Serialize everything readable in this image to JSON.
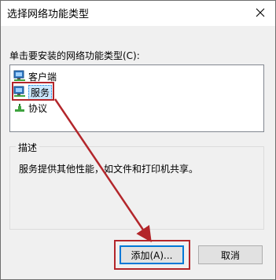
{
  "window": {
    "title": "选择网络功能类型"
  },
  "prompt": "单击要安装的网络功能类型(C):",
  "list": {
    "items": [
      {
        "label": "客户端",
        "icon": "client-network-icon"
      },
      {
        "label": "服务",
        "icon": "service-network-icon",
        "selected": true
      },
      {
        "label": "协议",
        "icon": "protocol-icon"
      }
    ]
  },
  "description": {
    "title": "描述",
    "text": "服务提供其他性能，如文件和打印机共享。"
  },
  "buttons": {
    "add": "添加(A)...",
    "cancel": "取消"
  },
  "annotation": {
    "color": "#b3262b"
  }
}
